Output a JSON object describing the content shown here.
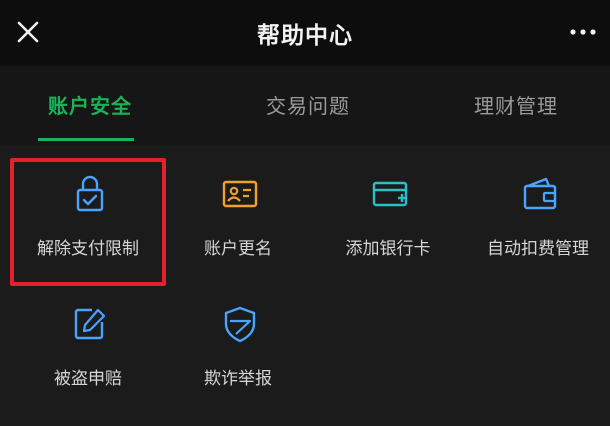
{
  "header": {
    "title": "帮助中心",
    "close_icon": "close-icon",
    "more_icon": "more-icon"
  },
  "tabs": [
    {
      "label": "账户安全",
      "active": true
    },
    {
      "label": "交易问题",
      "active": false
    },
    {
      "label": "理财管理",
      "active": false
    }
  ],
  "items": [
    {
      "label": "解除支付限制",
      "icon": "lock-icon",
      "icon_color": "#4aa3ff",
      "highlighted": true
    },
    {
      "label": "账户更名",
      "icon": "id-card-icon",
      "icon_color": "#f0a12a"
    },
    {
      "label": "添加银行卡",
      "icon": "bank-card-icon",
      "icon_color": "#2ac0c8"
    },
    {
      "label": "自动扣费管理",
      "icon": "wallet-icon",
      "icon_color": "#4aa3ff"
    },
    {
      "label": "被盗申赔",
      "icon": "edit-icon",
      "icon_color": "#4aa3ff"
    },
    {
      "label": "欺诈举报",
      "icon": "shield-icon",
      "icon_color": "#4aa3ff"
    }
  ],
  "colors": {
    "accent": "#19b35a",
    "highlight_border": "#e0222c",
    "background": "#1b1b1b"
  }
}
